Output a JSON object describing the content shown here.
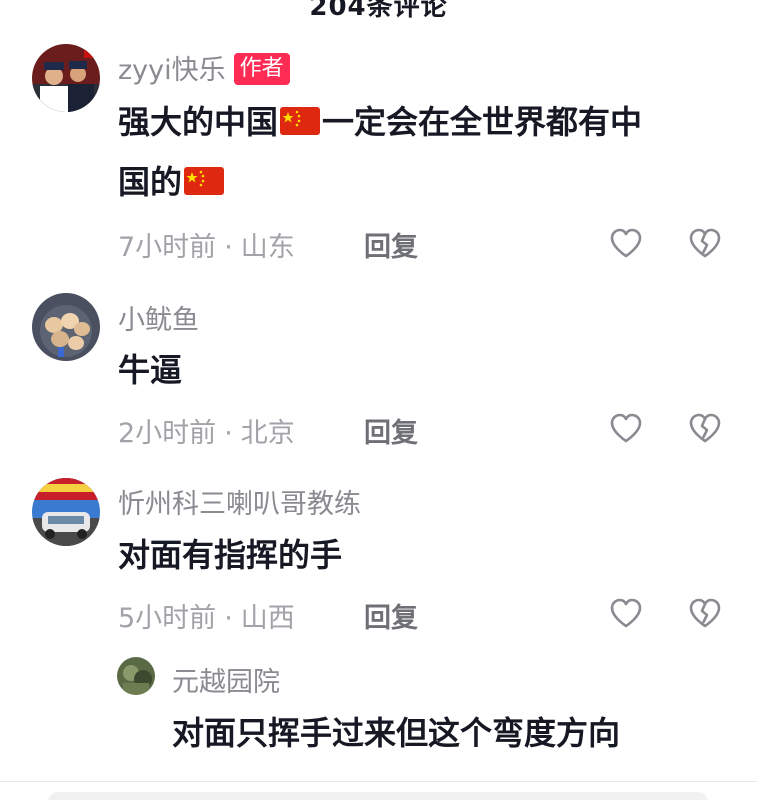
{
  "header": {
    "title": "204条评论"
  },
  "comments": [
    {
      "username": "zyyi快乐",
      "badge": "作者",
      "text_line1": "强大的中国",
      "text_line1b": "一定会在全世界都有中",
      "text_line2": "国的",
      "time": "7小时前",
      "location": "山东",
      "reply": "回复"
    },
    {
      "username": "小鱿鱼",
      "text": "牛逼",
      "time": "2小时前",
      "location": "北京",
      "reply": "回复"
    },
    {
      "username": "忻州科三喇叭哥教练",
      "text": "对面有指挥的手",
      "time": "5小时前",
      "location": "山西",
      "reply": "回复"
    }
  ],
  "reply": {
    "username": "元越园院",
    "text": "对面只挥手过来但这个弯度方向"
  },
  "separator": "·",
  "icons": {
    "like": "heart-outline-icon",
    "dislike": "broken-heart-icon",
    "flag": "china-flag-emoji"
  },
  "colors": {
    "badge": "#fe2c55",
    "username": "#8a8b91",
    "text": "#161823",
    "meta": "#a2a3a8"
  }
}
